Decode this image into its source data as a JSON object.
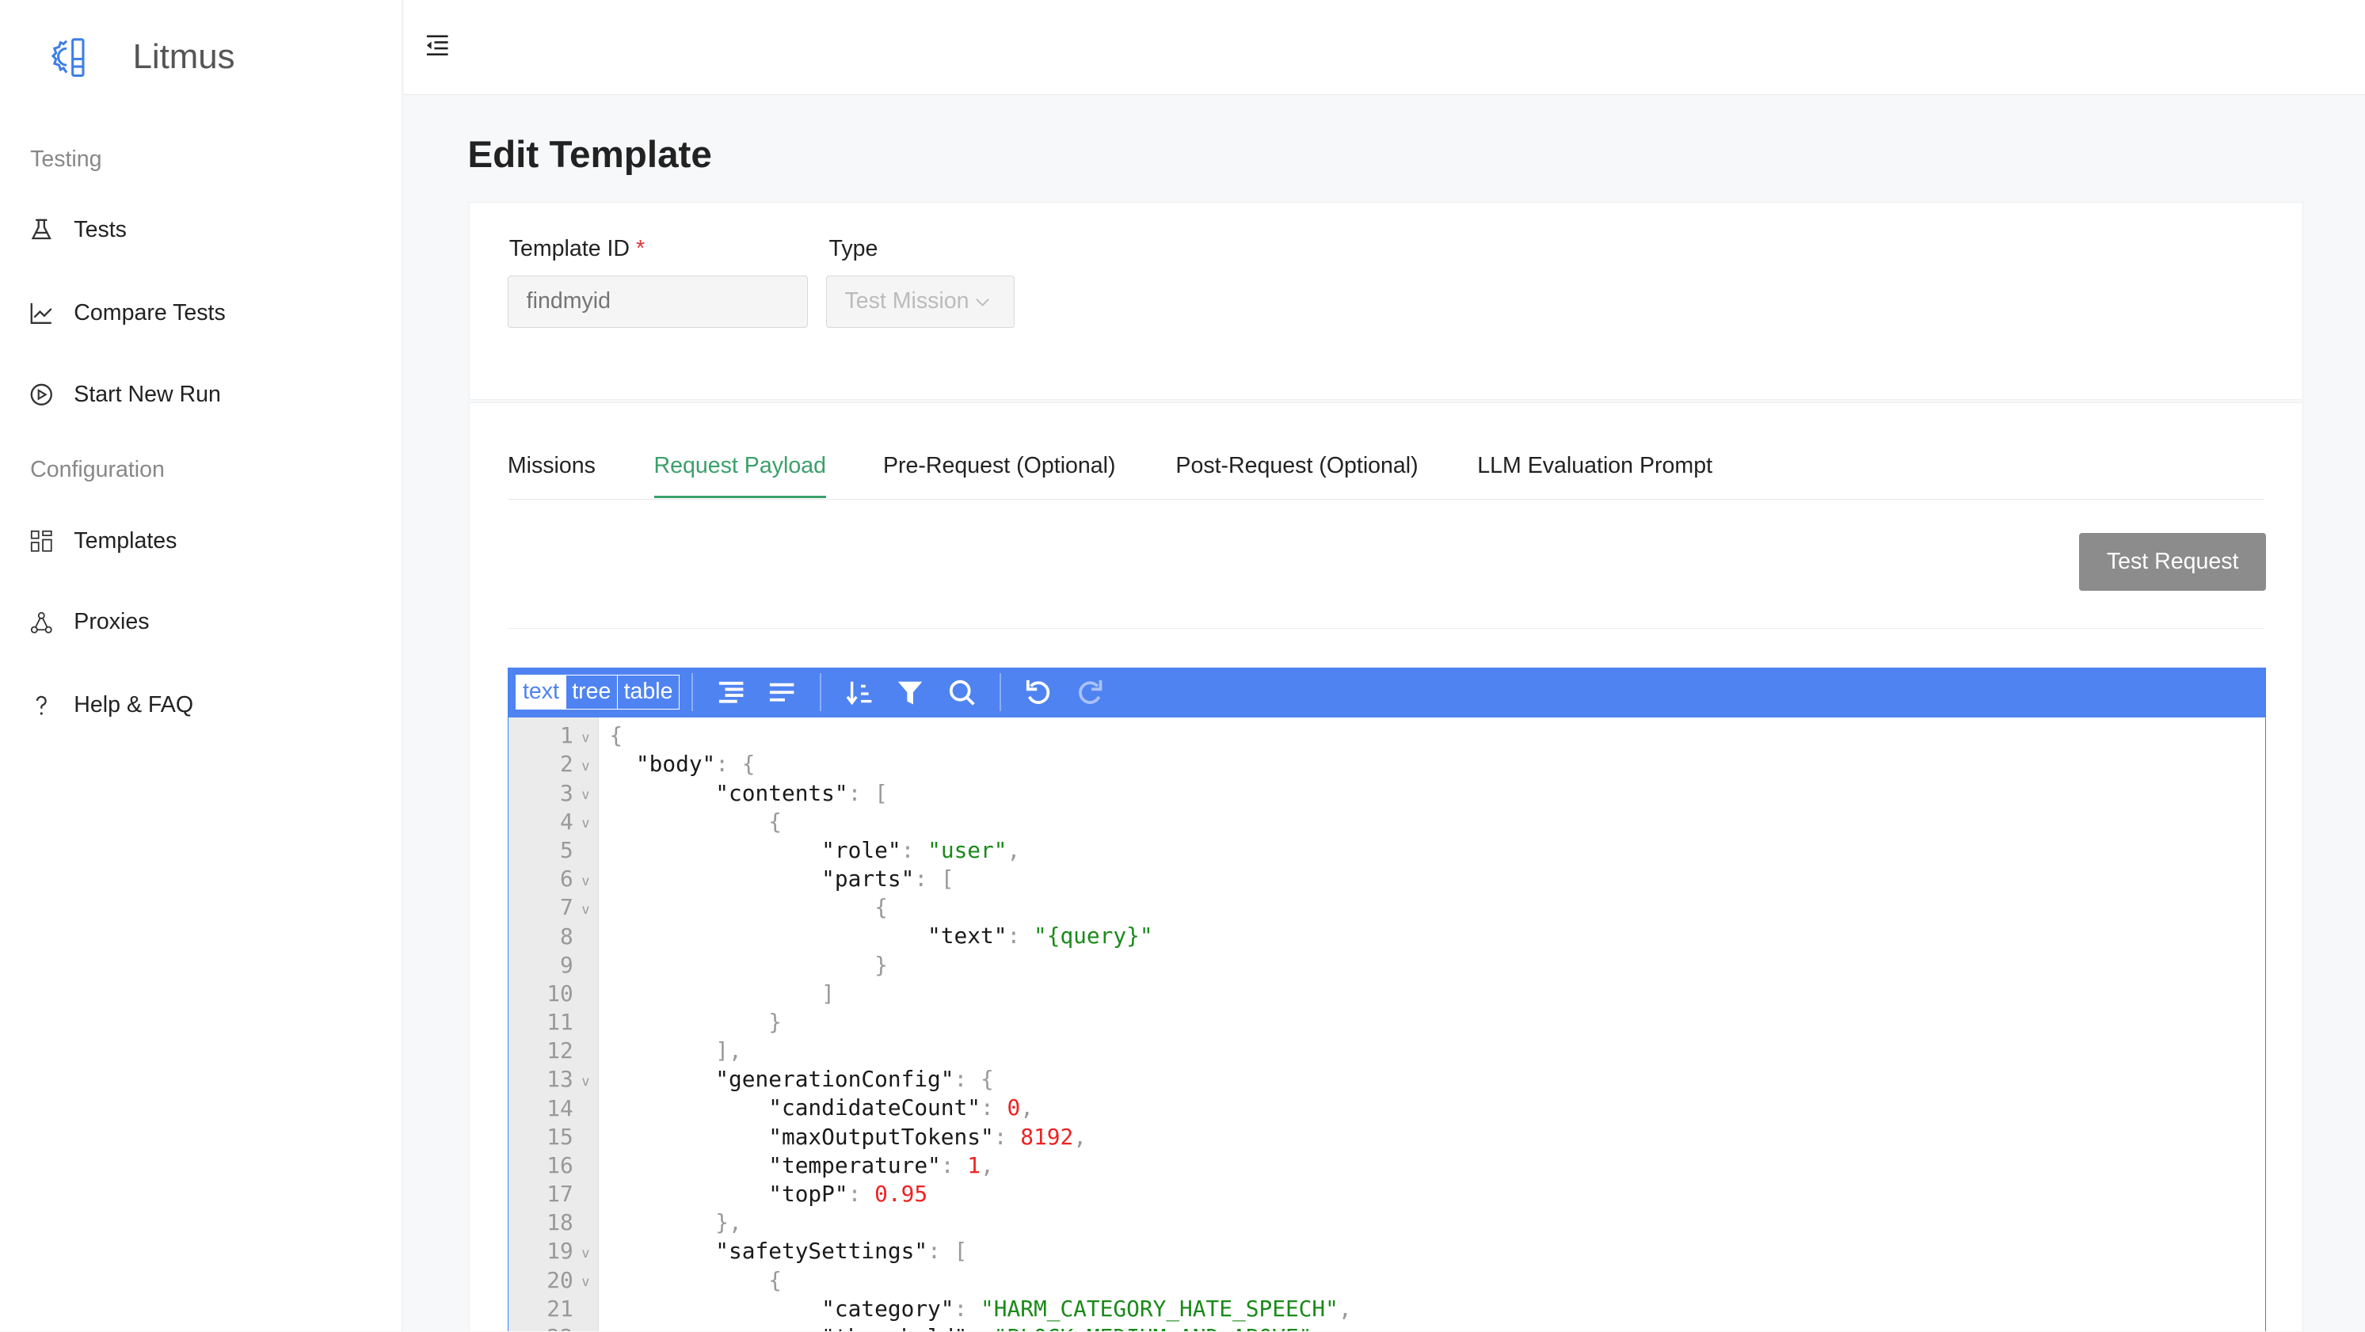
{
  "app": {
    "name": "Litmus",
    "brand_color": "#4f83f1",
    "accent_color": "#3aa06a"
  },
  "sidebar": {
    "sections": [
      {
        "title": "Testing",
        "items": [
          {
            "label": "Tests",
            "icon": "flask-icon"
          },
          {
            "label": "Compare Tests",
            "icon": "line-chart-icon"
          },
          {
            "label": "Start New Run",
            "icon": "play-circle-icon"
          }
        ]
      },
      {
        "title": "Configuration",
        "items": [
          {
            "label": "Templates",
            "icon": "grid-icon"
          },
          {
            "label": "Proxies",
            "icon": "network-icon"
          },
          {
            "label": "Help & FAQ",
            "icon": "question-icon"
          }
        ]
      }
    ]
  },
  "page": {
    "title": "Edit Template"
  },
  "form": {
    "template_id_label": "Template ID",
    "required_mark": "*",
    "template_id_placeholder": "findmyid",
    "type_label": "Type",
    "type_value": "Test Mission"
  },
  "tabs": [
    {
      "label": "Missions"
    },
    {
      "label": "Request Payload",
      "active": true
    },
    {
      "label": "Pre-Request (Optional)"
    },
    {
      "label": "Post-Request (Optional)"
    },
    {
      "label": "LLM Evaluation Prompt"
    }
  ],
  "test_request_label": "Test Request",
  "editor": {
    "modes": [
      "text",
      "tree",
      "table"
    ],
    "active_mode": "text",
    "lines": [
      "{",
      "  \"body\": {",
      "        \"contents\": [",
      "            {",
      "                \"role\": \"user\",",
      "                \"parts\": [",
      "                    {",
      "                        \"text\": \"{query}\"",
      "                    }",
      "                ]",
      "            }",
      "        ],",
      "        \"generationConfig\": {",
      "            \"candidateCount\": 0,",
      "            \"maxOutputTokens\": 8192,",
      "            \"temperature\": 1,",
      "            \"topP\": 0.95",
      "        },",
      "        \"safetySettings\": [",
      "            {",
      "                \"category\": \"HARM_CATEGORY_HATE_SPEECH\",",
      "                \"threshold\": \"BLOCK_MEDIUM_AND_ABOVE\""
    ],
    "folds": [
      1,
      2,
      3,
      4,
      6,
      7,
      13,
      19,
      20
    ]
  }
}
